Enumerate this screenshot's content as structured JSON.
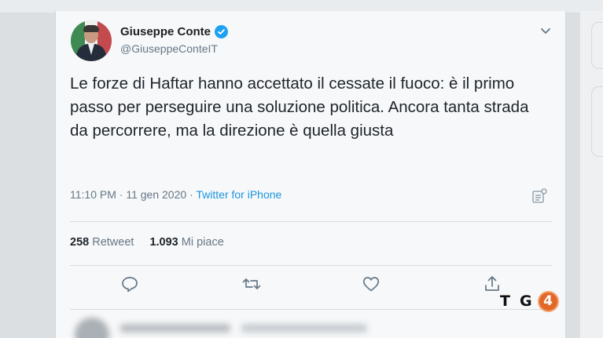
{
  "tweet": {
    "author": {
      "name": "Giuseppe Conte",
      "handle": "@GiuseppeConteIT",
      "verified_icon": "verified-badge-icon",
      "avatar": "profile-photo"
    },
    "text": "Le forze di Haftar hanno accettato il cessate il fuoco: è il primo passo per perseguire una soluzione politica. Ancora tanta strada da percorrere, ma la direzione è quella giusta",
    "time": "11:10 PM",
    "separator": " · ",
    "date": "11 gen 2020",
    "source": "Twitter for iPhone",
    "stats": {
      "retweets_count": "258",
      "retweets_label": "Retweet",
      "likes_count": "1.093",
      "likes_label": "Mi piace"
    },
    "actions": [
      "reply-icon",
      "retweet-icon",
      "like-icon",
      "share-icon"
    ],
    "menu_icon": "chevron-down-icon",
    "analytics_icon": "analytics-icon"
  },
  "watermark": {
    "letters": [
      "T",
      "G",
      "4"
    ]
  },
  "colors": {
    "accent": "#1da1f2",
    "link": "#1b95e0",
    "muted": "#657786",
    "logo_orange": "#e2682a"
  }
}
